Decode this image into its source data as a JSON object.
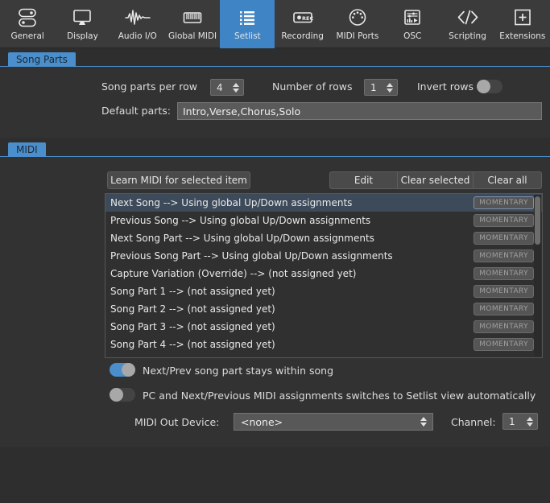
{
  "toolbar": {
    "items": [
      {
        "label": "General",
        "icon": "sliders-icon",
        "active": false
      },
      {
        "label": "Display",
        "icon": "monitor-icon",
        "active": false
      },
      {
        "label": "Audio I/O",
        "icon": "waveform-icon",
        "active": false
      },
      {
        "label": "Global MIDI",
        "icon": "keyboard-icon",
        "active": false
      },
      {
        "label": "Setlist",
        "icon": "list-icon",
        "active": true
      },
      {
        "label": "Recording",
        "icon": "record-icon",
        "active": false
      },
      {
        "label": "MIDI Ports",
        "icon": "midi-din-icon",
        "active": false
      },
      {
        "label": "OSC",
        "icon": "osc-panel-icon",
        "active": false
      },
      {
        "label": "Scripting",
        "icon": "code-icon",
        "active": false
      },
      {
        "label": "Extensions",
        "icon": "plus-box-icon",
        "active": false
      }
    ]
  },
  "song_parts": {
    "tab_label": "Song Parts",
    "parts_per_row_label": "Song parts per row",
    "parts_per_row_value": "4",
    "number_of_rows_label": "Number of rows",
    "number_of_rows_value": "1",
    "invert_rows_label": "Invert rows",
    "invert_rows_on": false,
    "default_parts_label": "Default parts:",
    "default_parts_value": "Intro,Verse,Chorus,Solo",
    "default_parts_placeholder": ""
  },
  "midi": {
    "tab_label": "MIDI",
    "learn_button": "Learn MIDI for selected item",
    "edit_button": "Edit",
    "clear_selected_button": "Clear selected",
    "clear_all_button": "Clear all",
    "assignments": [
      {
        "text": "Next Song --> Using global Up/Down assignments",
        "badge": "MOMENTARY",
        "selected": true
      },
      {
        "text": "Previous Song --> Using global Up/Down assignments",
        "badge": "MOMENTARY",
        "selected": false
      },
      {
        "text": "Next Song Part --> Using global Up/Down assignments",
        "badge": "MOMENTARY",
        "selected": false
      },
      {
        "text": "Previous Song Part --> Using global Up/Down assignments",
        "badge": "MOMENTARY",
        "selected": false
      },
      {
        "text": "Capture Variation (Override) --> (not assigned yet)",
        "badge": "MOMENTARY",
        "selected": false
      },
      {
        "text": "Song Part 1 --> (not assigned yet)",
        "badge": "MOMENTARY",
        "selected": false
      },
      {
        "text": "Song Part 2 --> (not assigned yet)",
        "badge": "MOMENTARY",
        "selected": false
      },
      {
        "text": "Song Part 3 --> (not assigned yet)",
        "badge": "MOMENTARY",
        "selected": false
      },
      {
        "text": "Song Part 4 --> (not assigned yet)",
        "badge": "MOMENTARY",
        "selected": false
      }
    ],
    "toggle_stay_within_song_label": "Next/Prev song part stays within song",
    "toggle_stay_within_song_on": true,
    "toggle_switch_setlist_label": "PC and Next/Previous MIDI assignments switches to Setlist view automatically",
    "toggle_switch_setlist_on": false,
    "midi_out_device_label": "MIDI Out Device:",
    "midi_out_device_value": "<none>",
    "channel_label": "Channel:",
    "channel_value": "1"
  },
  "colors": {
    "accent": "#4a8fcc",
    "window_bg": "#2e2e2e",
    "panel_bg": "#323232",
    "toolbar_bg": "#3b3b3b",
    "selected_row": "#3c4a5a"
  }
}
